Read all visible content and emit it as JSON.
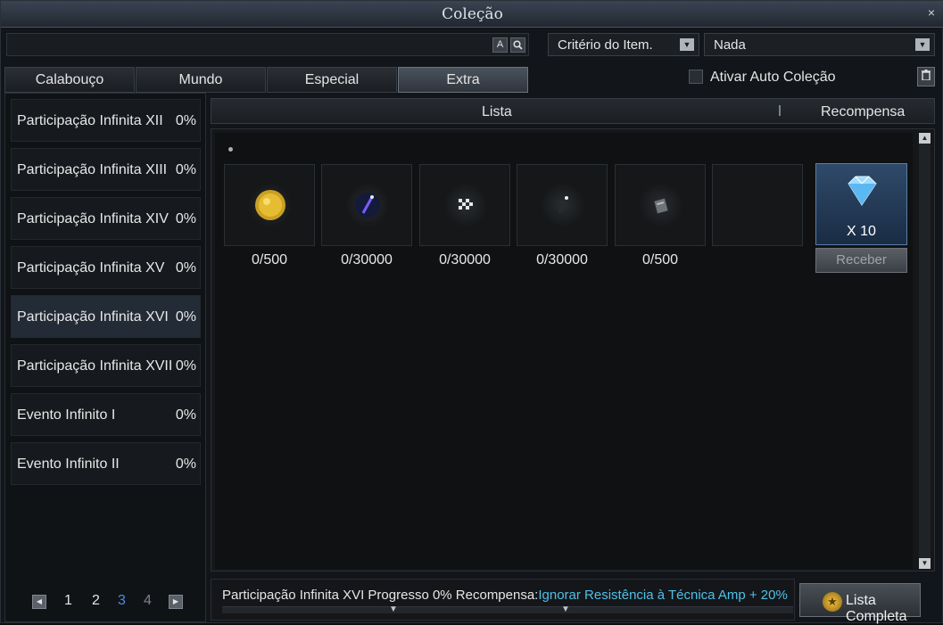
{
  "window": {
    "title": "Coleção",
    "close": "×"
  },
  "toolbar": {
    "search_placeholder": "",
    "btn_a": "A",
    "btn_search": "🔍",
    "criteria_label": "Critério do Item.",
    "filter_value": "Nada"
  },
  "tabs": [
    {
      "label": "Calabouço"
    },
    {
      "label": "Mundo"
    },
    {
      "label": "Especial"
    },
    {
      "label": "Extra",
      "active": true
    }
  ],
  "auto_collection": {
    "label": "Ativar Auto Coleção",
    "checked": false
  },
  "sidebar": {
    "items": [
      {
        "name": "Participação Infinita XII",
        "percent": "0%"
      },
      {
        "name": "Participação Infinita XIII",
        "percent": "0%"
      },
      {
        "name": "Participação Infinita XIV",
        "percent": "0%"
      },
      {
        "name": "Participação Infinita XV",
        "percent": "0%"
      },
      {
        "name": "Participação Infinita XVI",
        "percent": "0%",
        "selected": true
      },
      {
        "name": "Participação Infinita XVII",
        "percent": "0%"
      },
      {
        "name": "Evento Infinito I",
        "percent": "0%"
      },
      {
        "name": "Evento Infinito II",
        "percent": "0%"
      }
    ],
    "pages": [
      "1",
      "2",
      "3",
      "4"
    ],
    "current_page": "3"
  },
  "header": {
    "list": "Lista",
    "reward": "Recompensa"
  },
  "items": [
    {
      "icon": "gold-coin-icon",
      "count": "0/500"
    },
    {
      "icon": "blue-wand-icon",
      "count": "0/30000"
    },
    {
      "icon": "checkered-flag-icon",
      "count": "0/30000"
    },
    {
      "icon": "dark-wand-icon",
      "count": "0/30000"
    },
    {
      "icon": "scroll-icon",
      "count": "0/500"
    },
    {
      "icon": "empty-slot",
      "count": ""
    }
  ],
  "reward": {
    "icon": "diamond-icon",
    "quantity": "X 10",
    "button": "Receber"
  },
  "footer": {
    "status": "Participação Infinita XVI Progresso 0% Recompensa:",
    "reward_text": "Ignorar Resistência à Técnica Amp + 20%",
    "full_list": "Lista Completa"
  },
  "colors": {
    "accent": "#4fc0e8",
    "selected_page": "#4a8ee0"
  }
}
